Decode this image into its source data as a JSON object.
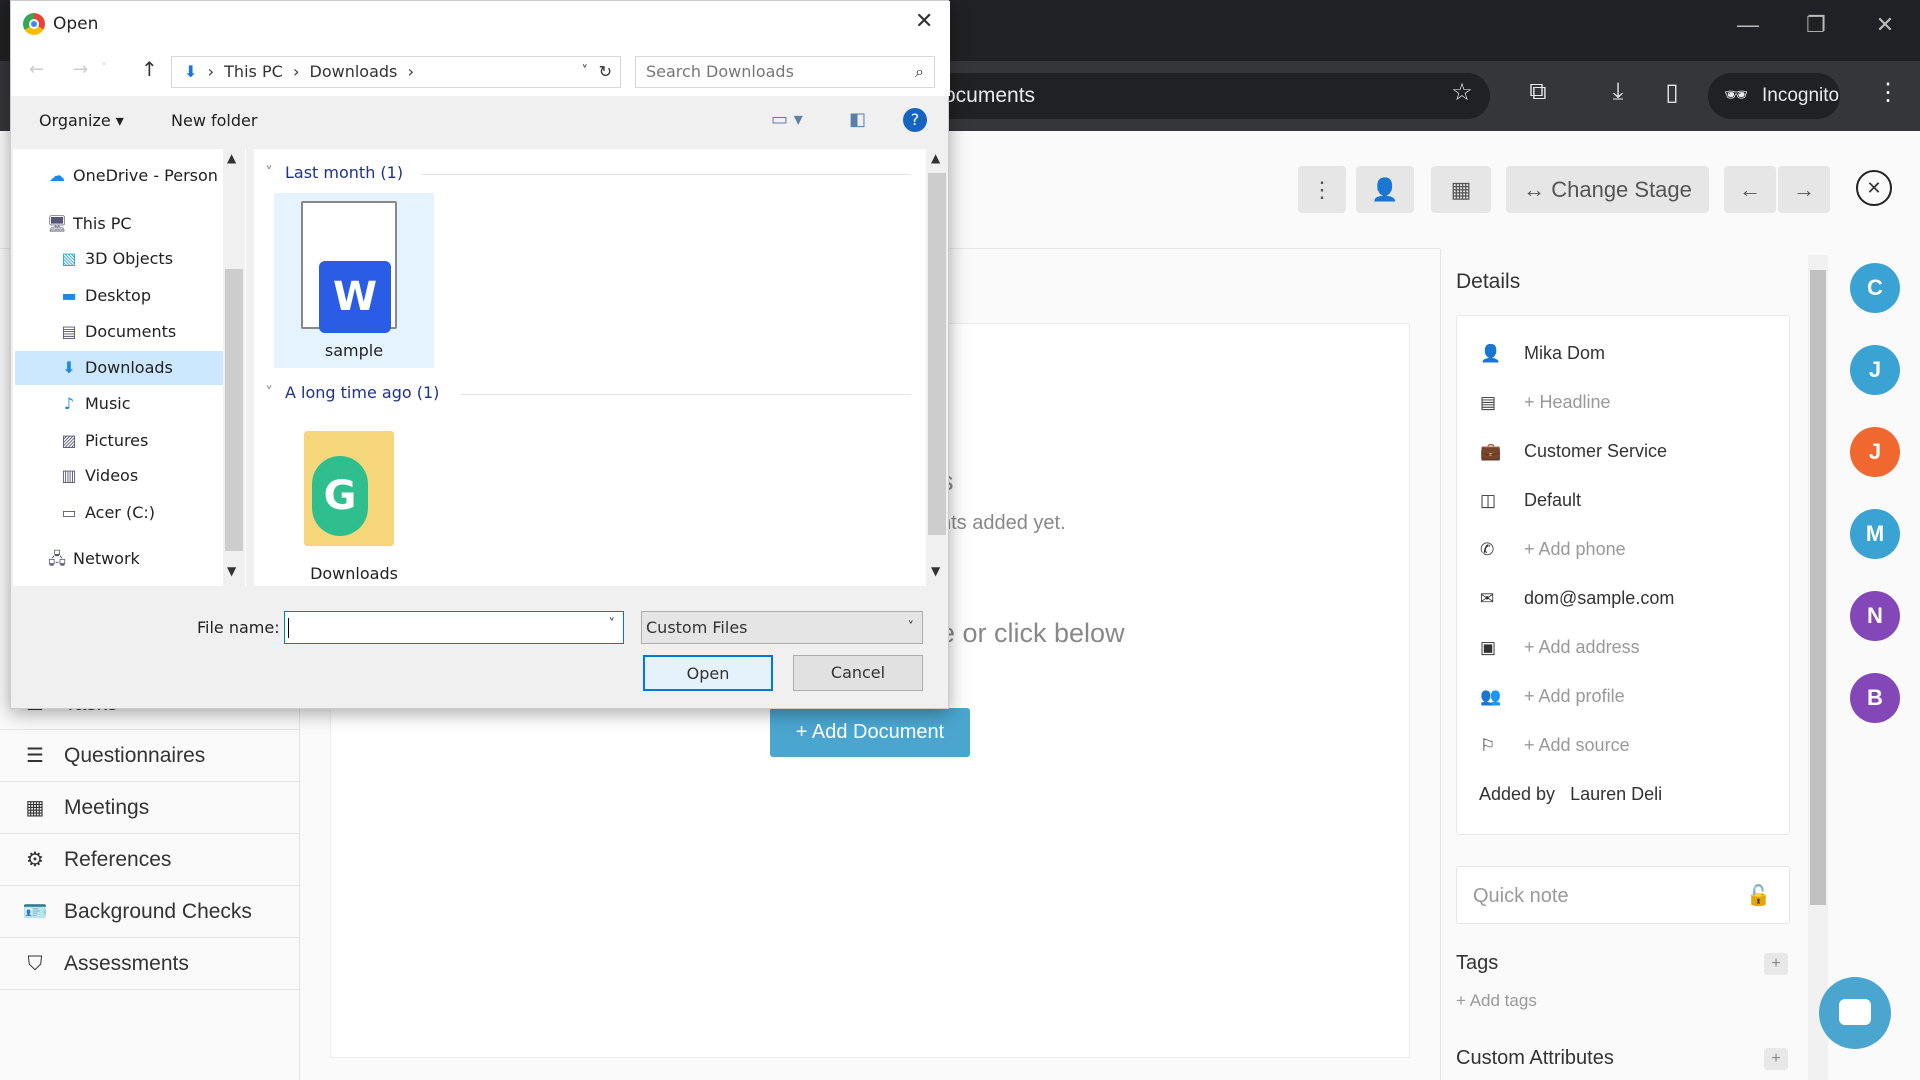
{
  "browser": {
    "omnibox_text": "ocuments",
    "incognito_label": "Incognito",
    "icons": [
      "star-icon",
      "extensions-icon",
      "download-icon",
      "side-panel-icon",
      "incognito-icon",
      "kebab-menu-icon"
    ]
  },
  "header": {
    "change_stage_label": "Change Stage"
  },
  "sidebar": {
    "items": [
      {
        "label": "Tasks",
        "icon": "checkbox-icon"
      },
      {
        "label": "Questionnaires",
        "icon": "list-icon"
      },
      {
        "label": "Meetings",
        "icon": "calendar-icon"
      },
      {
        "label": "References",
        "icon": "gear-icon"
      },
      {
        "label": "Background Checks",
        "icon": "id-card-icon"
      },
      {
        "label": "Assessments",
        "icon": "shield-check-icon"
      }
    ]
  },
  "main": {
    "empty_title_fragment": "s",
    "empty_sub_fragment": "nts added yet.",
    "drop_hint_fragment": "e or click below",
    "add_document_label": "+ Add Document",
    "accent": "#4aa6cf"
  },
  "details": {
    "title": "Details",
    "rows": [
      {
        "icon": "user-icon",
        "value": "Mika Dom",
        "muted": false
      },
      {
        "icon": "newspaper-icon",
        "value": "+ Headline",
        "muted": true
      },
      {
        "icon": "briefcase-icon",
        "value": "Customer Service",
        "muted": false
      },
      {
        "icon": "table-icon",
        "value": "Default",
        "muted": false
      },
      {
        "icon": "phone-icon",
        "value": "+ Add phone",
        "muted": true
      },
      {
        "icon": "envelope-icon",
        "value": "dom@sample.com",
        "muted": false
      },
      {
        "icon": "address-card-icon",
        "value": "+ Add address",
        "muted": true
      },
      {
        "icon": "users-icon",
        "value": "+ Add profile",
        "muted": true
      },
      {
        "icon": "flag-icon",
        "value": "+ Add source",
        "muted": true
      }
    ],
    "added_by_label": "Added by",
    "added_by_value": "Lauren Deli",
    "quick_note_placeholder": "Quick note",
    "tags_title": "Tags",
    "add_tags": "+ Add tags",
    "custom_attributes_title": "Custom Attributes"
  },
  "avatars": [
    {
      "letter": "C",
      "color": "#3aa3d3"
    },
    {
      "letter": "J",
      "color": "#3aa3d3"
    },
    {
      "letter": "J",
      "color": "#f0682f"
    },
    {
      "letter": "M",
      "color": "#3aa3d3"
    },
    {
      "letter": "N",
      "color": "#8447b8"
    },
    {
      "letter": "B",
      "color": "#8447b8"
    }
  ],
  "dialog": {
    "title": "Open",
    "breadcrumb": [
      "This PC",
      "Downloads"
    ],
    "search_placeholder": "Search Downloads",
    "organize_label": "Organize",
    "new_folder_label": "New folder",
    "nav_items": [
      {
        "label": "OneDrive - Person",
        "icon": "cloud-icon"
      },
      {
        "label": "This PC",
        "icon": "computer-icon"
      },
      {
        "label": "3D Objects",
        "icon": "cube-icon"
      },
      {
        "label": "Desktop",
        "icon": "desktop-icon"
      },
      {
        "label": "Documents",
        "icon": "document-icon"
      },
      {
        "label": "Downloads",
        "icon": "download-arrow-icon",
        "selected": true
      },
      {
        "label": "Music",
        "icon": "music-icon"
      },
      {
        "label": "Pictures",
        "icon": "picture-icon"
      },
      {
        "label": "Videos",
        "icon": "video-icon"
      },
      {
        "label": "Acer (C:)",
        "icon": "drive-icon"
      },
      {
        "label": "Network",
        "icon": "network-icon"
      }
    ],
    "groups": [
      {
        "header": "Last month (1)",
        "file": "sample"
      },
      {
        "header": "A long time ago (1)",
        "file": "Downloads"
      }
    ],
    "file_name_label": "File name:",
    "file_name_value": "",
    "file_type": "Custom Files",
    "open_label": "Open",
    "cancel_label": "Cancel"
  }
}
